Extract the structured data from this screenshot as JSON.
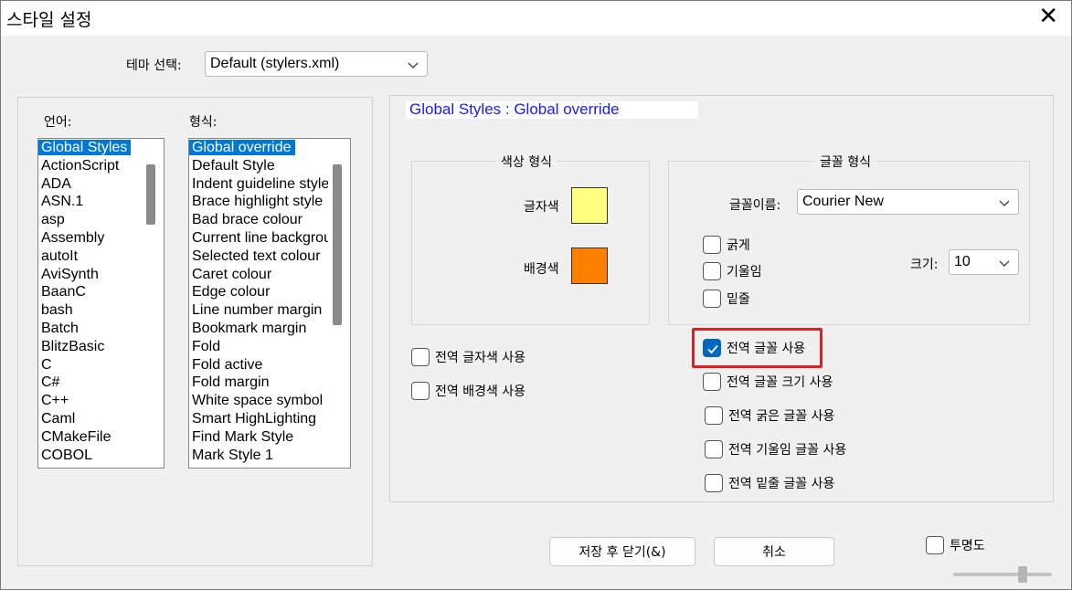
{
  "window": {
    "title": "스타일 설정"
  },
  "theme": {
    "label": "테마 선택:",
    "value": "Default (stylers.xml)"
  },
  "language": {
    "label": "언어:",
    "items": [
      "Global Styles",
      "ActionScript",
      "ADA",
      "ASN.1",
      "asp",
      "Assembly",
      "autoIt",
      "AviSynth",
      "BaanC",
      "bash",
      "Batch",
      "BlitzBasic",
      "C",
      "C#",
      "C++",
      "Caml",
      "CMakeFile",
      "COBOL"
    ],
    "selected": "Global Styles"
  },
  "style": {
    "label": "형식:",
    "items": [
      "Global override",
      "Default Style",
      "Indent guideline style",
      "Brace highlight style",
      "Bad brace colour",
      "Current line background colour",
      "Selected text colour",
      "Caret colour",
      "Edge colour",
      "Line number margin",
      "Bookmark margin",
      "Fold",
      "Fold active",
      "Fold margin",
      "White space symbol",
      "Smart HighLighting",
      "Find Mark Style",
      "Mark Style 1"
    ],
    "selected": "Global override"
  },
  "heading": "Global Styles : Global override",
  "color_group": {
    "caption": "색상 형식",
    "fg_label": "글자색",
    "bg_label": "배경색",
    "fg_color": "#ffff80",
    "bg_color": "#ff8000"
  },
  "font_group": {
    "caption": "글꼴 형식",
    "name_label": "글꼴이름:",
    "name_value": "Courier New",
    "size_label": "크기:",
    "size_value": "10",
    "bold": "굵게",
    "italic": "기울임",
    "underline": "밑줄"
  },
  "global_checks": {
    "fg": "전역 글자색 사용",
    "bg": "전역 배경색 사용",
    "font": "전역 글꼴 사용",
    "font_size": "전역 글꼴 크기 사용",
    "bold": "전역 굵은 글꼴 사용",
    "italic": "전역 기울임 글꼴 사용",
    "underline": "전역 밑줄 글꼴 사용"
  },
  "buttons": {
    "save_close": "저장 후 닫기(&)",
    "cancel": "취소"
  },
  "transparency": {
    "label": "투명도"
  },
  "colors": {
    "accent": "#0067c0",
    "selection": "#0078d7",
    "highlight": "#e02020",
    "heading": "#1a1aff"
  }
}
